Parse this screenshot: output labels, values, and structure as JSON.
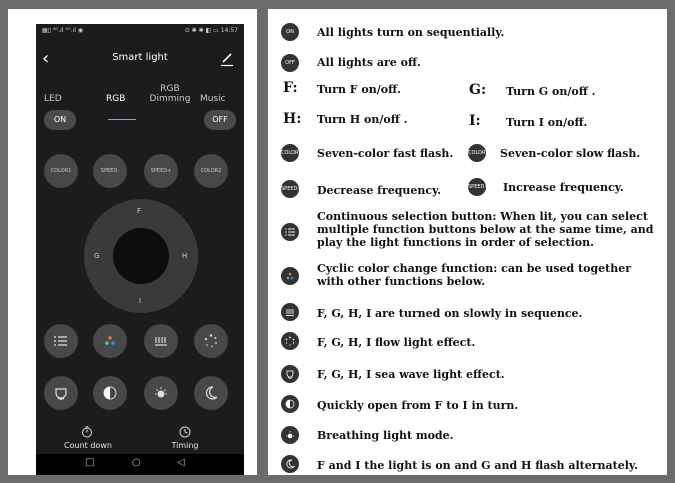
{
  "phone": {
    "status_left": "▦▯ ⁴ᴳ.ıl ⁴ᴳ.ıl ◉",
    "status_right": "⊙ ✱ ✱ ◧ ▭ 14:57",
    "title": "Smart light",
    "tabs": [
      "LED",
      "RGB",
      "RGB Dimming",
      "Music"
    ],
    "on_label": "ON",
    "off_label": "OFF",
    "buttons_row": [
      "COLOR1",
      "SPEED-",
      "SPEED+",
      "COLOR2"
    ],
    "wheel": {
      "top": "F",
      "left": "G",
      "right": "H",
      "bottom": "I"
    },
    "icon_rows": [
      [
        "list-icon",
        "dots-cycle-icon",
        "lamps-icon",
        "spin-dots-icon"
      ],
      [
        "wave-icon",
        "half-moon-icon",
        "sun-icon",
        "crescent-icon"
      ]
    ],
    "countdown_label": "Count down",
    "timing_label": "Timing"
  },
  "legend": {
    "on_icon": "ON",
    "off_icon": "OFF",
    "on_text": "All lights turn on sequentially.",
    "off_text": "All lights are off.",
    "f_letter": "F:",
    "f_text": "Turn F on/off.",
    "g_letter": "G:",
    "g_text": "Turn G on/off .",
    "h_letter": "H:",
    "h_text": "Turn H on/off .",
    "i_letter": "I:",
    "i_text": "Turn I on/off.",
    "color1_icon": "COLOR1",
    "color1_text": "Seven-color fast flash.",
    "color2_icon": "COLOR2",
    "color2_text": "Seven-color slow flash.",
    "speed_minus_icon": "SPEED-",
    "speed_minus_text": "Decrease frequency.",
    "speed_plus_icon": "SPEED+",
    "speed_plus_text": "Increase frequency.",
    "continuous_text": "Continuous selection button: When lit, you can select multiple function buttons below at the same time, and play the light functions in order of selection.",
    "cyclic_text": "Cyclic color change function: can be used together with other functions below.",
    "slow_on_text": "F, G, H, I are turned on slowly in sequence.",
    "flow_text": "F, G, H, I flow light effect.",
    "sea_wave_text": "F, G, H, I sea wave light effect.",
    "quick_open_text": "Quickly open from F to I in turn.",
    "breathing_text": "Breathing light mode.",
    "alternate_text": "F and I the light is on and G and H flash alternately."
  }
}
